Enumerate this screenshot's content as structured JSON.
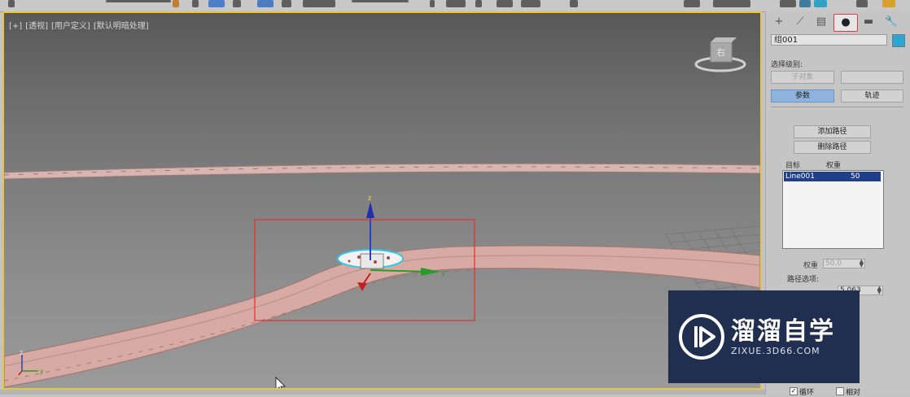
{
  "viewport": {
    "label_plus": "[+]",
    "label_view": "[透视]",
    "label_custom": "[用户定义]",
    "label_shading": "[默认明暗处理]",
    "viewcube_face": "右",
    "gizmo_axes": {
      "z": "z",
      "y": "y",
      "x": "x"
    },
    "corner_axes": {
      "z": "z",
      "y": "y"
    }
  },
  "command_panel": {
    "tabs": [
      {
        "icon": "create-icon",
        "glyph": "+"
      },
      {
        "icon": "modify-icon",
        "glyph": "⟋"
      },
      {
        "icon": "hierarchy-icon",
        "glyph": "▤"
      },
      {
        "icon": "motion-icon",
        "glyph": "●",
        "active": true
      },
      {
        "icon": "display-icon",
        "glyph": "▬"
      },
      {
        "icon": "utilities-icon",
        "glyph": "🔧"
      }
    ],
    "object_name": "组001",
    "object_color": "#29a6d6",
    "selection_level_label": "选择级别:",
    "sub_object_button": "子对象",
    "parameters_button": "参数",
    "trajectories_button": "轨迹",
    "add_path_button": "添加路径",
    "delete_path_button": "删除路径",
    "target_header": "目标",
    "weight_header": "权重",
    "path_list": [
      {
        "name": "Line001",
        "weight": "50"
      }
    ],
    "weight_label": "权重",
    "weight_value": "50.0",
    "path_options_label": "路径选项:",
    "percent_value": "5.063",
    "loop_label": "循环",
    "relative_label": "相对"
  },
  "watermark": {
    "text": "溜溜自学",
    "url": "ZIXUE.3D66.COM"
  }
}
